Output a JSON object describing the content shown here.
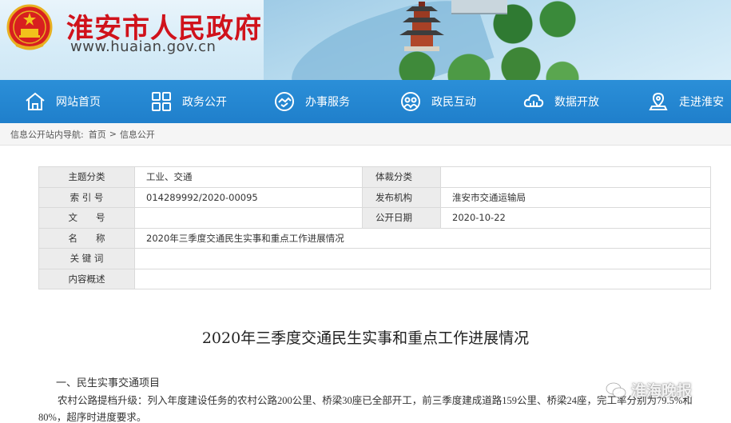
{
  "header": {
    "site_title": "淮安市人民政府",
    "site_url": "www.huaian.gov.cn"
  },
  "nav": {
    "items": [
      {
        "label": "网站首页",
        "icon": "home-icon"
      },
      {
        "label": "政务公开",
        "icon": "grid-icon"
      },
      {
        "label": "办事服务",
        "icon": "handshake-icon"
      },
      {
        "label": "政民互动",
        "icon": "people-icon"
      },
      {
        "label": "数据开放",
        "icon": "cloud-data-icon"
      },
      {
        "label": "走进淮安",
        "icon": "location-icon"
      }
    ]
  },
  "breadcrumb": {
    "prefix": "信息公开站内导航:",
    "home": "首页",
    "separator": ">",
    "current": "信息公开"
  },
  "info_table": {
    "topic_label": "主题分类",
    "topic_value": "工业、交通",
    "genre_label": "体裁分类",
    "genre_value": "",
    "index_label": "索 引 号",
    "index_value": "014289992/2020-00095",
    "publisher_label": "发布机构",
    "publisher_value": "淮安市交通运输局",
    "docno_label": "文　　号",
    "docno_value": "",
    "date_label": "公开日期",
    "date_value": "2020-10-22",
    "name_label": "名　　称",
    "name_value": "2020年三季度交通民生实事和重点工作进展情况",
    "keywords_label": "关 键 词",
    "keywords_value": "",
    "summary_label": "内容概述",
    "summary_value": ""
  },
  "article": {
    "title": "2020年三季度交通民生实事和重点工作进展情况",
    "section1": "一、民生实事交通项目",
    "para1": "农村公路提档升级：列入年度建设任务的农村公路200公里、桥梁30座已全部开工，前三季度建成道路159公里、桥梁24座，完工率分别为79.5%和",
    "para2": "80%，超序时进度要求。"
  },
  "watermark": {
    "text": "淮海晚报"
  },
  "colors": {
    "title_red": "#d0121b",
    "nav_blue": "#1f7fcb"
  }
}
